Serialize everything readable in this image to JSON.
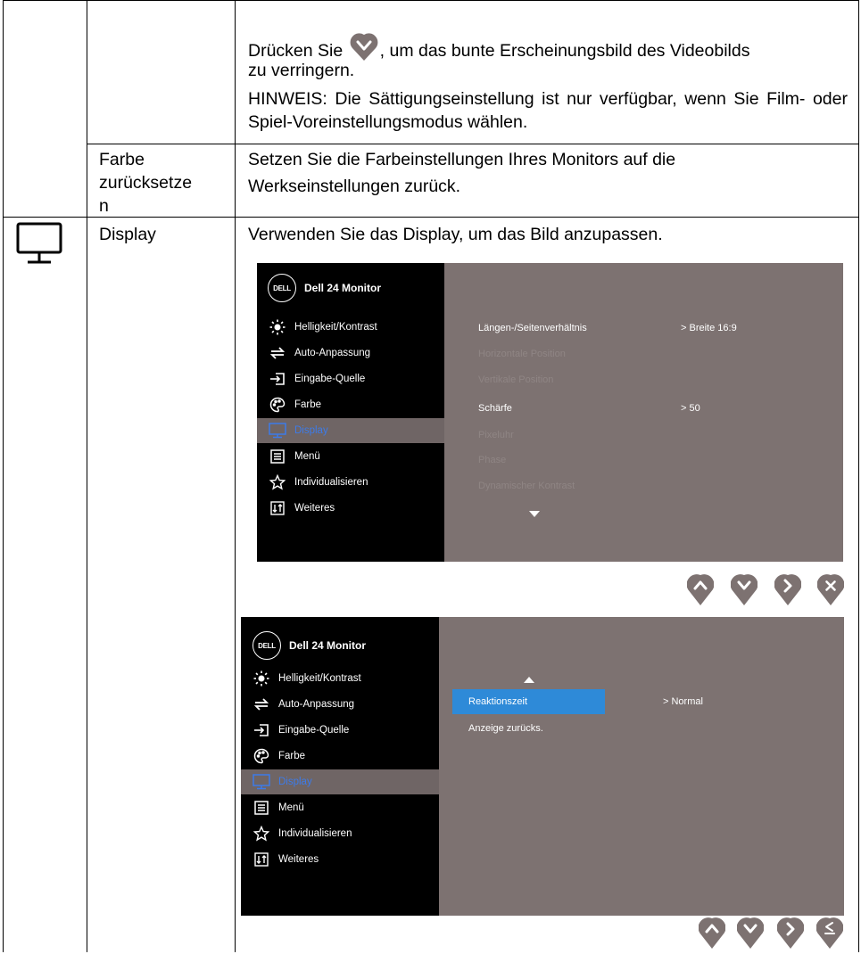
{
  "table": {
    "row1": {
      "text_before_icon": "Drücken Sie",
      "text_after_icon": ", um das bunte Erscheinungsbild des Videobilds",
      "text_line2": "zu verringern.",
      "note": "HINWEIS: Die Sättigungseinstellung ist nur verfügbar, wenn Sie Film- oder Spiel-Voreinstellungsmodus wählen."
    },
    "row2": {
      "label_lines": [
        "Farbe",
        "zurücksetze",
        "n"
      ],
      "description": "Setzen Sie die Farbeinstellungen Ihres Monitors auf die Werkseinstellungen zurück."
    },
    "row3": {
      "icon": "monitor-icon",
      "label": "Display",
      "description": "Verwenden Sie das Display, um das Bild anzupassen."
    }
  },
  "osd1": {
    "logo": "DELL",
    "title": "Dell 24 Monitor",
    "menu": [
      {
        "icon": "brightness-icon",
        "label": "Helligkeit/Kontrast"
      },
      {
        "icon": "auto-adjust-icon",
        "label": "Auto-Anpassung"
      },
      {
        "icon": "input-source-icon",
        "label": "Eingabe-Quelle"
      },
      {
        "icon": "palette-icon",
        "label": "Farbe"
      },
      {
        "icon": "display-icon",
        "label": "Display"
      },
      {
        "icon": "menu-icon",
        "label": "Menü"
      },
      {
        "icon": "star-icon",
        "label": "Individualisieren"
      },
      {
        "icon": "others-icon",
        "label": "Weiteres"
      }
    ],
    "active_index": 4,
    "options": [
      {
        "label": "Längen-/Seitenverhältnis",
        "value": "> Breite 16:9"
      },
      {
        "label": "Horizontale Position",
        "value": ""
      },
      {
        "label": "Vertikale Position",
        "value": ""
      },
      {
        "label": "Schärfe",
        "value": "> 50"
      },
      {
        "label": "Pixeluhr",
        "value": ""
      },
      {
        "label": "Phase",
        "value": ""
      },
      {
        "label": "Dynamischer Kontrast",
        "value": ""
      }
    ],
    "buttons": [
      "up-icon",
      "down-icon",
      "right-icon",
      "close-icon"
    ]
  },
  "osd2": {
    "logo": "DELL",
    "title": "Dell 24 Monitor",
    "menu": [
      {
        "icon": "brightness-icon",
        "label": "Helligkeit/Kontrast"
      },
      {
        "icon": "auto-adjust-icon",
        "label": "Auto-Anpassung"
      },
      {
        "icon": "input-source-icon",
        "label": "Eingabe-Quelle"
      },
      {
        "icon": "palette-icon",
        "label": "Farbe"
      },
      {
        "icon": "display-icon",
        "label": "Display"
      },
      {
        "icon": "menu-icon",
        "label": "Menü"
      },
      {
        "icon": "star-icon",
        "label": "Individualisieren"
      },
      {
        "icon": "others-icon",
        "label": "Weiteres"
      }
    ],
    "active_index": 4,
    "options": [
      {
        "label": "Reaktionszeit",
        "value": "> Normal"
      },
      {
        "label": "Anzeige zurücks.",
        "value": ""
      }
    ],
    "highlight_color": "#2e8ad8",
    "buttons": [
      "up-icon",
      "down-icon",
      "right-icon",
      "back-icon"
    ]
  },
  "colors": {
    "osd_side": "#000000",
    "osd_main": "#7d7271",
    "active_text": "#3d7be8",
    "button": "#7d7271"
  }
}
